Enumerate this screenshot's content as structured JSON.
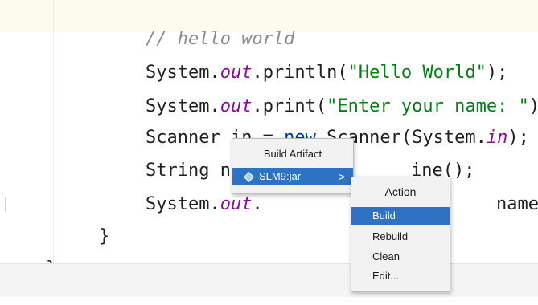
{
  "editor": {
    "lines": {
      "l1_comment": "// hello world",
      "l2_a": "System.",
      "l2_b": "out",
      "l2_c": ".println(",
      "l2_d": "\"Hello World\"",
      "l2_e": ");",
      "l3_a": "System.",
      "l3_b": "out",
      "l3_c": ".print(",
      "l3_d": "\"Enter your name: \"",
      "l3_e": ");",
      "l4_a": "Scanner in = ",
      "l4_b": "new",
      "l4_c": " Scanner(System.",
      "l4_d": "in",
      "l4_e": ");",
      "l5_a": "String name",
      "l5_b": "ine();",
      "l6_a": "System.",
      "l6_b": "out",
      "l6_c": ".",
      "l6_d": "name);",
      "l7": "}",
      "l8": "}"
    }
  },
  "build_artifact_popup": {
    "title": "Build Artifact",
    "item_label": "SLM9:jar",
    "chevron": ">"
  },
  "action_popup": {
    "title": "Action",
    "items": [
      "Build",
      "Rebuild",
      "Clean",
      "Edit..."
    ]
  },
  "colors": {
    "selection": "#2f72c4",
    "string": "#067d17",
    "keyword": "#0033b3",
    "field": "#871094",
    "comment": "#8c8c8c"
  }
}
